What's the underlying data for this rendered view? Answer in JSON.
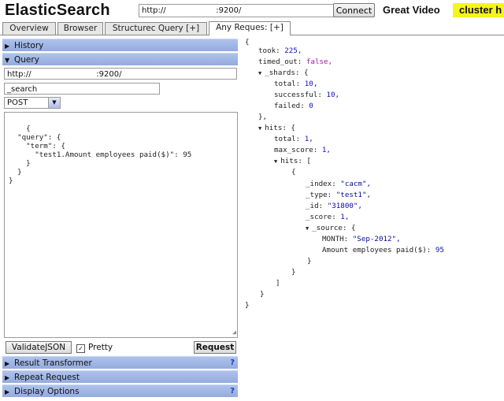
{
  "header": {
    "app_title": "ElasticSearch",
    "url_value": "http://                    :9200/",
    "connect_label": "Connect",
    "cluster_name": "Great Video",
    "cluster_status": "cluster h"
  },
  "tabs": [
    {
      "label": "Overview"
    },
    {
      "label": "Browser"
    },
    {
      "label": "Structurec Query [+]"
    },
    {
      "label": "Any Reques: [+]"
    }
  ],
  "left": {
    "history_label": "History",
    "query_label": "Query",
    "host_value": "http://                          :9200/",
    "path_value": "_search",
    "method_value": "POST",
    "query_body": "{\n  \"query\": {\n    \"term\": {\n      \"test1.Amount employees paid($)\": 95\n    }\n  }\n}",
    "validate_label": "ValidateJSON",
    "pretty_label": "Pretty",
    "pretty_checked": true,
    "request_label": "Request",
    "result_transformer_label": "Result Transformer",
    "repeat_request_label": "Repeat Request",
    "display_options_label": "Display Options",
    "help_glyph": "?"
  },
  "result": {
    "open_brace": "{",
    "took_key": "took:",
    "took_value": "225,",
    "timed_out_key": "timed_out:",
    "timed_out_value": "false,",
    "shards_key": "_shards: {",
    "total_key": "total:",
    "total_value": "10,",
    "successful_key": "successful:",
    "successful_value": "10,",
    "failed_key": "failed:",
    "failed_value": "0",
    "shards_close": "},",
    "hits_key": "hits: {",
    "hits_total_key": "total:",
    "hits_total_value": "1,",
    "max_score_key": "max_score:",
    "max_score_value": "1,",
    "hits_arr_key": "hits: [",
    "obj_open": "{",
    "index_key": "_index:",
    "index_value": "\"cacm\",",
    "type_key": "_type:",
    "type_value": "\"test1\",",
    "id_key": "_id:",
    "id_value": "\"31800\",",
    "score_key": "_score:",
    "score_value": "1,",
    "source_key": "_source: {",
    "month_key": "MONTH:",
    "month_value": "\"Sep-2012\",",
    "amount_key": "Amount employees paid($):",
    "amount_value": "95",
    "source_close": "}",
    "obj_close": "}",
    "arr_close": "]",
    "hits_close": "}",
    "close_brace": "}",
    "toggle_glyph": "▼"
  }
}
